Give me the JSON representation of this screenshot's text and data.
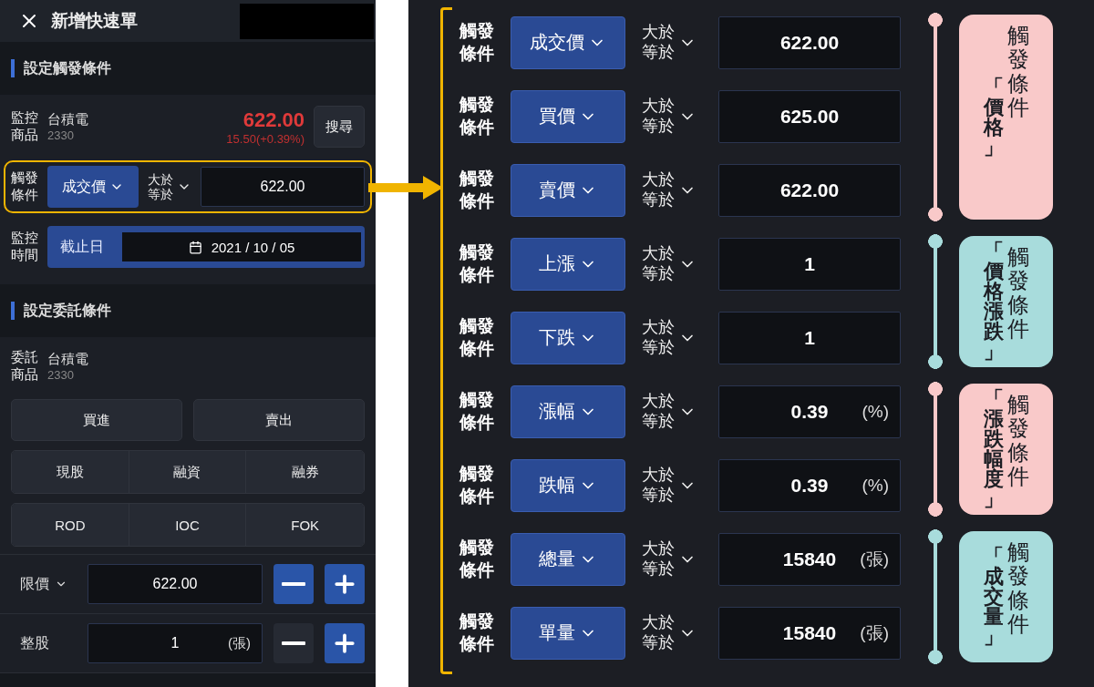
{
  "header": {
    "title": "新增快速單"
  },
  "trigger_section": {
    "title": "設定觸發條件",
    "monitor": {
      "label": "監控商品",
      "name": "台積電",
      "code": "2330",
      "price": "622.00",
      "change": "15.50(+0.39%)",
      "search_button": "搜尋"
    },
    "condition": {
      "label": "觸發條件",
      "field": "成交價",
      "operator": "大於等於",
      "value": "622.00",
      "highlighted": true
    },
    "period": {
      "label": "監控時間",
      "mode": "截止日",
      "date": "2021 / 10 / 05"
    }
  },
  "order_section": {
    "title": "設定委託條件",
    "product": {
      "label": "委託商品",
      "name": "台積電",
      "code": "2330"
    },
    "sides": [
      "買進",
      "賣出"
    ],
    "account_types": [
      "現股",
      "融資",
      "融券"
    ],
    "time_in_force": [
      "ROD",
      "IOC",
      "FOK"
    ],
    "price": {
      "label": "限價",
      "value": "622.00",
      "minus_disabled": false
    },
    "quantity": {
      "label": "整股",
      "value": "1",
      "unit": "(張)",
      "minus_disabled": true
    }
  },
  "groups": [
    {
      "highlight": "「價格」",
      "caption": "觸發條件",
      "color": "#f9c9c9",
      "rows": [
        {
          "label": "觸發條件",
          "field": "成交價",
          "operator": "大於等於",
          "value": "622.00"
        },
        {
          "label": "觸發條件",
          "field": "買價",
          "operator": "大於等於",
          "value": "625.00"
        },
        {
          "label": "觸發條件",
          "field": "賣價",
          "operator": "大於等於",
          "value": "622.00"
        }
      ]
    },
    {
      "highlight": "「價格漲跌」",
      "caption": "觸發條件",
      "color": "#a8dcdc",
      "rows": [
        {
          "label": "觸發條件",
          "field": "上漲",
          "operator": "大於等於",
          "value": "1"
        },
        {
          "label": "觸發條件",
          "field": "下跌",
          "operator": "大於等於",
          "value": "1"
        }
      ]
    },
    {
      "highlight": "「漲跌幅度」",
      "caption": "觸發條件",
      "color": "#f9c9c9",
      "rows": [
        {
          "label": "觸發條件",
          "field": "漲幅",
          "operator": "大於等於",
          "value": "0.39",
          "unit": "(%)"
        },
        {
          "label": "觸發條件",
          "field": "跌幅",
          "operator": "大於等於",
          "value": "0.39",
          "unit": "(%)"
        }
      ]
    },
    {
      "highlight": "「成交量」",
      "caption": "觸發條件",
      "color": "#a8dcdc",
      "rows": [
        {
          "label": "觸發條件",
          "field": "總量",
          "operator": "大於等於",
          "value": "15840",
          "unit": "(張)"
        },
        {
          "label": "觸發條件",
          "field": "單量",
          "operator": "大於等於",
          "value": "15840",
          "unit": "(張)"
        }
      ]
    }
  ]
}
